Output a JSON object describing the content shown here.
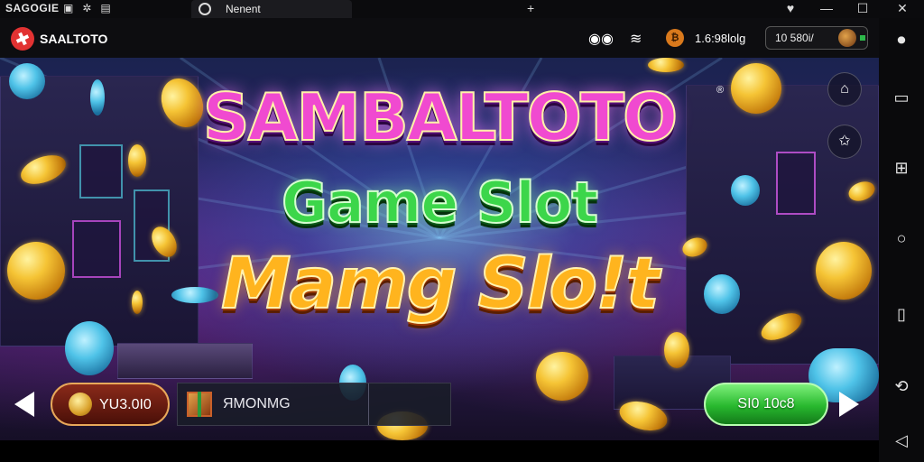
{
  "system_bar": {
    "left_text": "SAGOGIE",
    "tab_label": "Nenent",
    "tab_add": "+",
    "controls": [
      "♥",
      "—",
      "☐",
      "✕"
    ]
  },
  "header": {
    "logo_text": "SAALTOTO",
    "balance": "1.6:98lolg",
    "coin_icon": "coin-icon",
    "account_text": "10 580i/"
  },
  "game": {
    "title_line1": "SAMBALTOTO",
    "title_line2": "Game Slot",
    "title_line3": "Mamg Slo!t",
    "registered_mark": "®",
    "bonus_pill": "YU3.0I0",
    "info_text": "ЯMONMG",
    "play_button": "SI0 10c8"
  },
  "right_nav": [
    "record-icon",
    "window-icon",
    "grid-icon",
    "home-icon",
    "recent-icon",
    "rotate-icon",
    "back-icon"
  ],
  "colors": {
    "title_magenta": "#f04ad0",
    "title_green": "#3cd64a",
    "title_orange": "#ffb41e",
    "play_green": "#28b82e",
    "logo_red": "#e23232"
  }
}
